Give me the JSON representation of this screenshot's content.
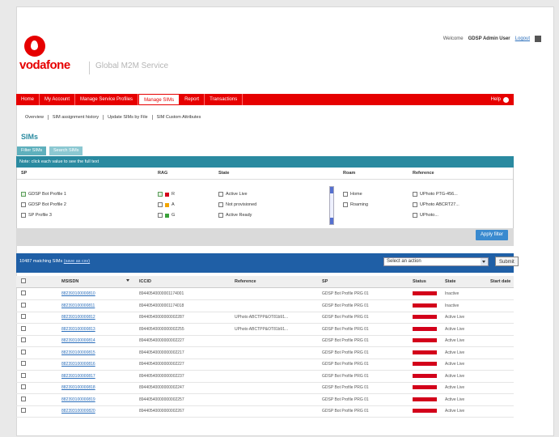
{
  "header": {
    "brand": "vodafone",
    "service": "Global M2M Service",
    "welcome_prefix": "Welcome",
    "user": "GDSP Admin User",
    "logout": "Logout"
  },
  "nav": {
    "items": [
      "Home",
      "My Account",
      "Manage Service Profiles",
      "Manage SIMs",
      "Report",
      "Transactions"
    ],
    "active": "Manage SIMs",
    "help": "Help"
  },
  "subnav": [
    "Overview",
    "SIM assignment history",
    "Update SIMs by File",
    "SIM Custom Attributes"
  ],
  "page_title": "SIMs",
  "tabs": [
    "Filter SIMs",
    "Search SIMs"
  ],
  "filter": {
    "heading": "Note: click each value to see the full text",
    "columns": [
      "SP",
      "RAG",
      "State",
      "Roam",
      "Reference"
    ],
    "sp_options": [
      "GDSP Bot Profile 1",
      "GDSP Bot Profile 2",
      "SP Profile 3"
    ],
    "rag_options": [
      "R",
      "A",
      "G"
    ],
    "state_options": [
      "Active Live",
      "Not provisioned",
      "Active Ready"
    ],
    "roam_options": [
      "Home",
      "Roaming"
    ],
    "reference_options": [
      "UPhoto PTG-456...",
      "UPhoto ABCRT27...",
      "UPhoto..."
    ],
    "apply_label": "Apply filter"
  },
  "results": {
    "count_text": "10487 matching SIMs",
    "export_link": "(save as csv)",
    "action_placeholder": "Select an action",
    "submit_label": "Submit"
  },
  "grid": {
    "columns": [
      "MSISDN",
      "ICCID",
      "Reference",
      "SP",
      "Status",
      "State",
      "Start date"
    ],
    "rows": [
      {
        "msisdn": "882393100000810",
        "iccid": "89440540000001174001",
        "ref": "",
        "sp": "GDSP Bot Profile PRG 01",
        "state": "Inactive"
      },
      {
        "msisdn": "882393100000811",
        "iccid": "89440540000001174018",
        "ref": "",
        "sp": "GDSP Bot Profile PRG 01",
        "state": "Inactive"
      },
      {
        "msisdn": "882393100000812",
        "iccid": "89440540000000002287",
        "ref": "UPhoto ABCTPP&OT81b91...",
        "sp": "GDSP Bot Profile PRG 01",
        "state": "Active Live"
      },
      {
        "msisdn": "882393100000813",
        "iccid": "89440540000000002255",
        "ref": "UPhoto ABCTPP&OT81b91...",
        "sp": "GDSP Bot Profile PRG 01",
        "state": "Active Live"
      },
      {
        "msisdn": "882393100000814",
        "iccid": "89440540000000002227",
        "ref": "",
        "sp": "GDSP Bot Profile PRG 01",
        "state": "Active Live"
      },
      {
        "msisdn": "882393100000815",
        "iccid": "89440540000000002217",
        "ref": "",
        "sp": "GDSP Bot Profile PRG 01",
        "state": "Active Live"
      },
      {
        "msisdn": "882393100000816",
        "iccid": "89440540000000002227",
        "ref": "",
        "sp": "GDSP Bot Profile PRG 01",
        "state": "Active Live"
      },
      {
        "msisdn": "882393100000817",
        "iccid": "89440540000000002237",
        "ref": "",
        "sp": "GDSP Bot Profile PRG 01",
        "state": "Active Live"
      },
      {
        "msisdn": "882393100000818",
        "iccid": "89440540000000002247",
        "ref": "",
        "sp": "GDSP Bot Profile PRG 01",
        "state": "Active Live"
      },
      {
        "msisdn": "882393100000819",
        "iccid": "89440540000000002257",
        "ref": "",
        "sp": "GDSP Bot Profile PRG 01",
        "state": "Active Live"
      },
      {
        "msisdn": "882393100000820",
        "iccid": "89440540000000002267",
        "ref": "",
        "sp": "GDSP Bot Profile PRG 01",
        "state": "Active Live"
      }
    ]
  },
  "colors": {
    "brand_red": "#e60000",
    "teal": "#2a8aa0",
    "results_blue": "#1f5fa6",
    "status_red": "#d3001a"
  }
}
